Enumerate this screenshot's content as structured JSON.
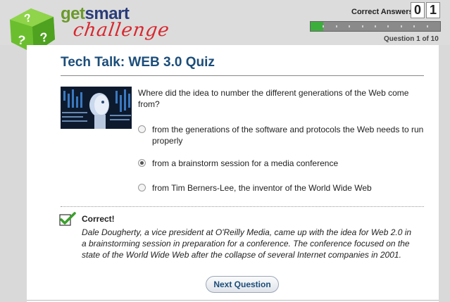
{
  "brand": {
    "get": "get",
    "smart": "smart",
    "challenge": "challenge"
  },
  "score": {
    "label": "Correct Answers",
    "digits": [
      "0",
      "1"
    ]
  },
  "progress": {
    "current": 1,
    "total": 10,
    "fraction": 0.1,
    "label": "Question 1 of 10"
  },
  "quiz": {
    "title": "Tech Talk: WEB 3.0 Quiz",
    "question": "Where did the idea to number the different generations of the Web come from?",
    "options": [
      {
        "label": "from the generations of the software and protocols the Web needs to run properly",
        "selected": false
      },
      {
        "label": "from a brainstorm session for a media conference",
        "selected": true
      },
      {
        "label": "from Tim Berners-Lee, the inventor of the World Wide Web",
        "selected": false
      }
    ]
  },
  "feedback": {
    "title": "Correct!",
    "text": "Dale Dougherty, a vice president at O'Reilly Media, came up with the idea for Web 2.0 in a brainstorming session in preparation for a conference. The conference focused on the state of the World Wide Web after the collapse of several Internet companies in 2001."
  },
  "next_button": "Next Question",
  "colors": {
    "accent": "#1b4d7a",
    "progress": "#3cae3c",
    "brand_red": "#d8262e",
    "brand_green": "#6a9a2a"
  }
}
